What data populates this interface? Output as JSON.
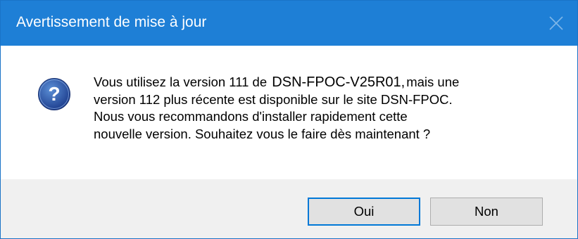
{
  "window": {
    "title": "Avertissement de mise à jour"
  },
  "icons": {
    "question": "question-icon",
    "close": "close-icon"
  },
  "message": {
    "line1_prefix": "Vous utilisez la version 111 de",
    "app_name": "DSN-FPOC-V25R01,",
    "line1_suffix": "mais une",
    "line2": "version 112 plus récente est disponible sur le site DSN-FPOC.",
    "line3": "Nous vous recommandons d'installer rapidement cette",
    "line4": "nouvelle version. Souhaitez vous le faire dès maintenant ?"
  },
  "buttons": {
    "yes_label": "Oui",
    "no_label": "Non"
  },
  "colors": {
    "titlebar": "#1e7fd6",
    "footer": "#f0f0f0",
    "default_button_border": "#0078d7"
  }
}
